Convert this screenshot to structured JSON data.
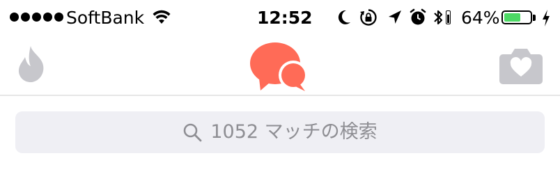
{
  "status_bar": {
    "carrier": "SoftBank",
    "time": "12:52",
    "battery_percent": "64%",
    "battery_level": 0.64,
    "signal_bars": 5,
    "icons": [
      "wifi-icon",
      "moon-icon",
      "rotation-lock-icon",
      "location-arrow-icon",
      "alarm-icon",
      "bluetooth-icon",
      "battery-icon",
      "charging-bolt-icon"
    ]
  },
  "nav": {
    "left_icon": "flame-icon",
    "center_icon": "chat-bubbles-icon",
    "right_icon": "camera-heart-icon",
    "active_color": "#ff6b57",
    "inactive_color": "#c7c7cc"
  },
  "search": {
    "placeholder": "1052 マッチの検索",
    "icon": "search-icon"
  },
  "colors": {
    "battery_fill": "#4cd964",
    "search_bg": "#efeff4",
    "placeholder_text": "#8e8e93"
  }
}
